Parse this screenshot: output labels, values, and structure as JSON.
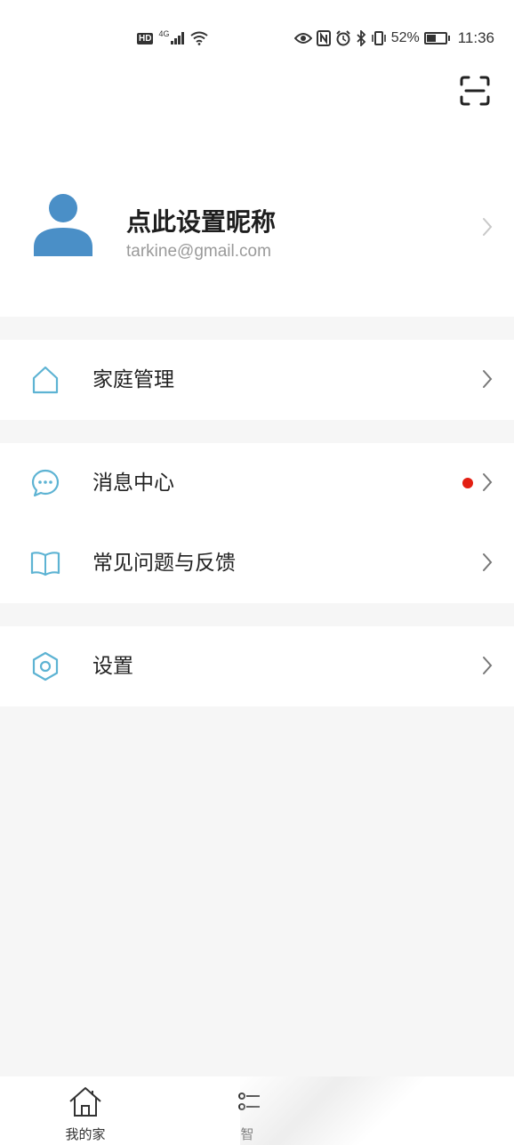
{
  "status_bar": {
    "hd": "HD",
    "network": "4G",
    "battery": "52%",
    "battery_level": 0.52,
    "time": "11:36",
    "icons": [
      "eye-icon",
      "nfc-icon",
      "alarm-icon",
      "bluetooth-icon",
      "vibrate-icon"
    ]
  },
  "header": {
    "scan_icon": "scan-icon"
  },
  "profile": {
    "nickname": "点此设置昵称",
    "email": "tarkine@gmail.com",
    "avatar_color": "#4a8fc7"
  },
  "menu": {
    "family": "家庭管理",
    "messages": "消息中心",
    "faq": "常见问题与反馈",
    "settings": "设置"
  },
  "colors": {
    "icon_accent": "#5db3d3",
    "unread_dot": "#e31f12"
  },
  "tabbar": {
    "tab1": "我的家",
    "tab2": "智"
  }
}
